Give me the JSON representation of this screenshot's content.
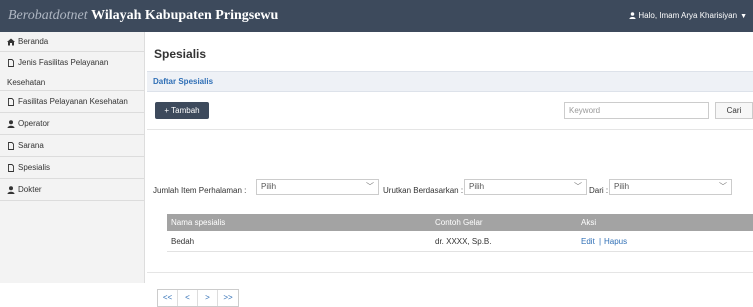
{
  "header": {
    "brand_italic": "Berobatdotnet",
    "brand_bold": "Wilayah Kabupaten Pringsewu",
    "user_label": "Halo, Imam Arya Kharisiyan",
    "colors": {
      "topbar": "#3d4a5c",
      "link": "#2f6fb6"
    }
  },
  "sidebar": {
    "items": [
      {
        "label": "Beranda",
        "icon": "home-icon"
      },
      {
        "label_line1": "Jenis Fasilitas Pelayanan",
        "label_line2": "Kesehatan",
        "icon": "document-icon"
      },
      {
        "label": "Fasilitas Pelayanan Kesehatan",
        "icon": "document-icon"
      },
      {
        "label": "Operator",
        "icon": "user-icon"
      },
      {
        "label": "Sarana",
        "icon": "document-icon"
      },
      {
        "label": "Spesialis",
        "icon": "document-icon"
      },
      {
        "label": "Dokter",
        "icon": "user-icon"
      }
    ]
  },
  "main": {
    "title": "Spesialis",
    "panel_title": "Daftar Spesialis",
    "add_button": "+ Tambah",
    "search": {
      "placeholder": "Keyword",
      "button": "Cari"
    },
    "filters": {
      "items_label": "Jumlah Item Perhalaman :",
      "items_value": "Pilih",
      "sort_label": "Urutkan Berdasarkan :",
      "sort_value": "Pilih",
      "from_label": "Dari :",
      "from_value": "Pilih"
    },
    "table": {
      "columns": [
        "Nama spesialis",
        "Contoh Gelar",
        "Aksi"
      ],
      "rows": [
        {
          "nama": "Bedah",
          "gelar": "dr. XXXX, Sp.B.",
          "edit": "Edit",
          "sep": "|",
          "hapus": "Hapus"
        }
      ]
    },
    "pagination": [
      "<<",
      "<",
      ">",
      ">>"
    ]
  }
}
